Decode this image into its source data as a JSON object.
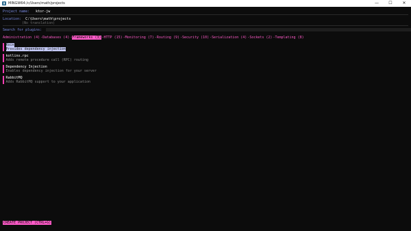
{
  "window": {
    "title": "MINGW64:/c/Users/math/projects",
    "controls": {
      "minimize": "—",
      "maximize": "☐",
      "close": "✕"
    }
  },
  "form": {
    "project_name_label": "Project name:",
    "project_name_value": "ktor-jw",
    "location_label": "Location:",
    "location_value": "C:\\Users\\math\\projects",
    "location_hint": "(No translation)",
    "search_label": "Search for plugins:"
  },
  "tabs": [
    {
      "label": "Administration (4)",
      "active": false
    },
    {
      "label": "Databases (4)",
      "active": false
    },
    {
      "label": "Frameworks (3)",
      "active": true
    },
    {
      "label": "HTTP (15)",
      "active": false
    },
    {
      "label": "Monitoring (7)",
      "active": false
    },
    {
      "label": "Routing (9)",
      "active": false
    },
    {
      "label": "Security (10)",
      "active": false
    },
    {
      "label": "Serialization (4)",
      "active": false
    },
    {
      "label": "Sockets (2)",
      "active": false
    },
    {
      "label": "Templating (8)",
      "active": false
    }
  ],
  "plugins": [
    {
      "name": "Koin",
      "description": "Provides dependency injection",
      "selected": true
    },
    {
      "name": "kotlinx.rpc",
      "description": "Adds remote procedure call (RPC) routing",
      "selected": false
    },
    {
      "name": "Dependency Injection",
      "description": "Enables dependency injection for your server",
      "selected": false
    },
    {
      "name": "RabbitMQ",
      "description": "Adds RabbitMQ support to your application",
      "selected": false
    }
  ],
  "create_button": "CREATE PROJECT (CTRL+G)",
  "colors": {
    "accent": "#ff5ac8",
    "label": "#7c8ee6",
    "selection": "#c3c8f5"
  }
}
